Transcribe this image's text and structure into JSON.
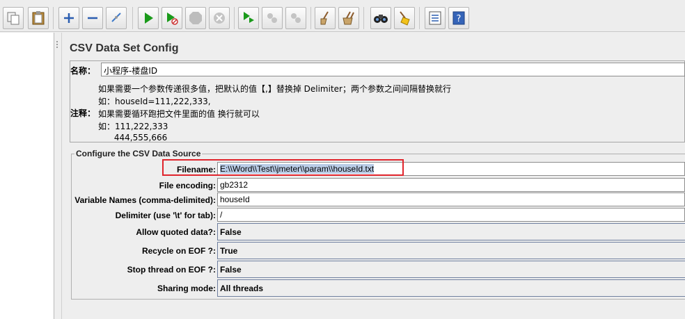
{
  "toolbar": {
    "buttons": [
      {
        "icon": "copy-icon"
      },
      {
        "icon": "paste-icon"
      },
      {
        "icon": "expand-all-icon"
      },
      {
        "icon": "collapse-all-icon"
      },
      {
        "icon": "toggle-icon"
      },
      {
        "icon": "start-icon"
      },
      {
        "icon": "start-no-pauses-icon"
      },
      {
        "icon": "stop-icon"
      },
      {
        "icon": "shutdown-icon"
      },
      {
        "icon": "remote-start-icon"
      },
      {
        "icon": "remote-stop-icon"
      },
      {
        "icon": "remote-shutdown-icon"
      },
      {
        "icon": "clear-icon"
      },
      {
        "icon": "clear-all-icon"
      },
      {
        "icon": "search-icon"
      },
      {
        "icon": "reset-search-icon"
      },
      {
        "icon": "function-helper-icon"
      },
      {
        "icon": "help-icon"
      }
    ]
  },
  "panel": {
    "title": "CSV Data Set Config",
    "name_label": "名称：",
    "name_value": "小程序-楼盘ID",
    "comment_label": "注释：",
    "comment_lines": [
      "如果需要一个参数传递很多值，把默认的值【,】替换掉 Delimiter；两个参数之间间隔替换就行",
      "如：houseId=111,222,333,",
      "如果需要循环跑把文件里面的值 换行就可以",
      "如：111,222,333",
      "      444,555,666"
    ]
  },
  "csv": {
    "legend": "Configure the CSV Data Source",
    "filename_label": "Filename:",
    "filename_value": "E:\\\\Word\\\\Test\\\\jmeter\\\\param\\\\houseId.txt",
    "encoding_label": "File encoding:",
    "encoding_value": "gb2312",
    "varnames_label": "Variable Names (comma-delimited):",
    "varnames_value": "houseId",
    "delimiter_label": "Delimiter (use '\\t' for tab):",
    "delimiter_value": "/",
    "quoted_label": "Allow quoted data?:",
    "quoted_value": "False",
    "recycle_label": "Recycle on EOF ?:",
    "recycle_value": "True",
    "stopthread_label": "Stop thread on EOF ?:",
    "stopthread_value": "False",
    "sharing_label": "Sharing mode:",
    "sharing_value": "All threads"
  },
  "colors": {
    "highlight": "#e0242c",
    "selection": "#b9cce6",
    "run_green": "#1a9a1a"
  }
}
